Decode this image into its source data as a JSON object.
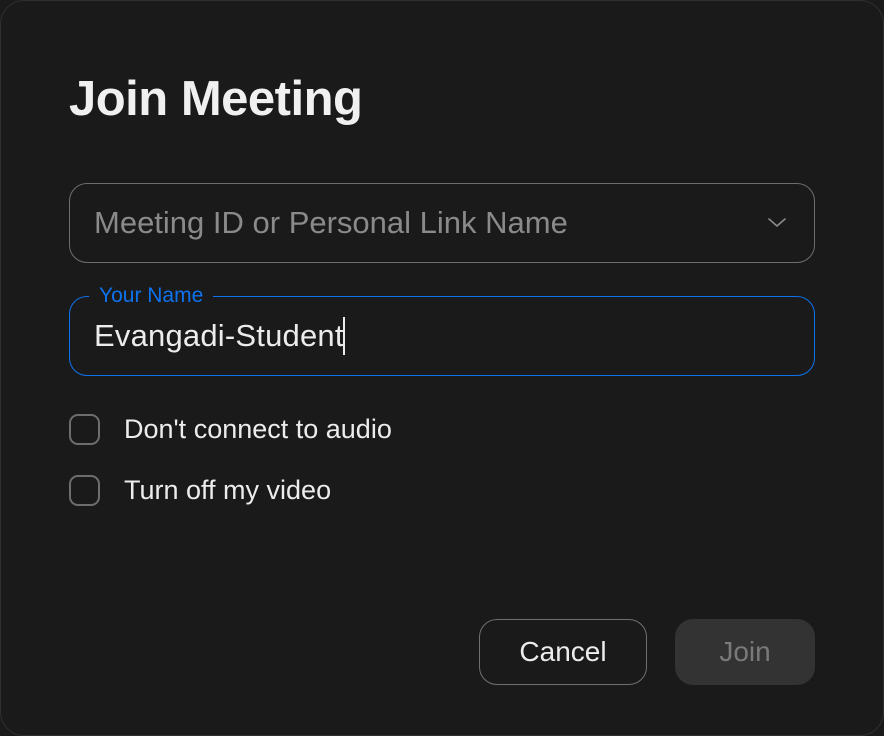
{
  "dialog": {
    "title": "Join Meeting",
    "meeting_id": {
      "placeholder": "Meeting ID or Personal Link Name",
      "value": ""
    },
    "name_field": {
      "label": "Your Name",
      "value": "Evangadi-Student"
    },
    "options": {
      "no_audio": {
        "label": "Don't connect to audio",
        "checked": false
      },
      "no_video": {
        "label": "Turn off my video",
        "checked": false
      }
    },
    "buttons": {
      "cancel": "Cancel",
      "join": "Join"
    }
  }
}
